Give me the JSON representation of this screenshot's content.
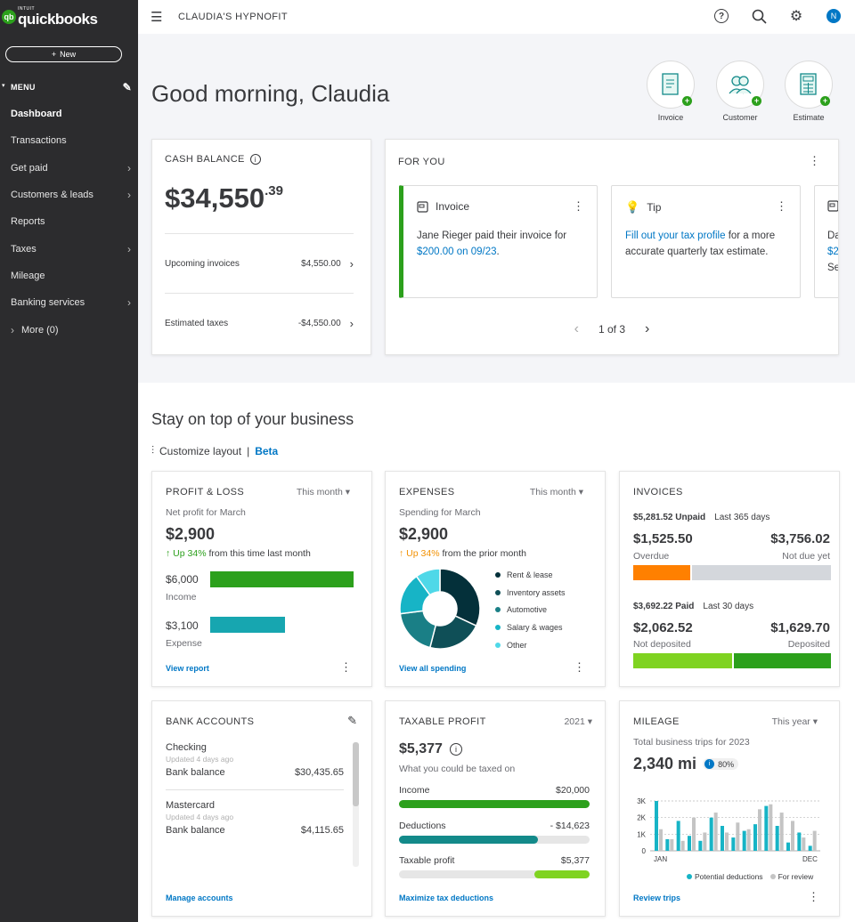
{
  "brand": {
    "intuit": "INTUIT",
    "name": "quickbooks",
    "mark": "qb"
  },
  "sidebar": {
    "new_label": "New",
    "menu_label": "MENU",
    "items": [
      {
        "label": "Dashboard",
        "active": true,
        "chevron": false
      },
      {
        "label": "Transactions",
        "active": false,
        "chevron": false
      },
      {
        "label": "Get paid",
        "active": false,
        "chevron": true
      },
      {
        "label": "Customers & leads",
        "active": false,
        "chevron": true
      },
      {
        "label": "Reports",
        "active": false,
        "chevron": false
      },
      {
        "label": "Taxes",
        "active": false,
        "chevron": true
      },
      {
        "label": "Mileage",
        "active": false,
        "chevron": false
      },
      {
        "label": "Banking services",
        "active": false,
        "chevron": true
      }
    ],
    "more_label": "More (0)"
  },
  "topbar": {
    "company": "CLAUDIA'S HYPNOFIT",
    "avatar_initial": "N"
  },
  "hero": {
    "greeting": "Good morning, Claudia",
    "quick_actions": [
      {
        "label": "Invoice"
      },
      {
        "label": "Customer"
      },
      {
        "label": "Estimate"
      }
    ]
  },
  "cash_balance": {
    "title": "CASH BALANCE",
    "amount_main": "$34,550",
    "amount_cents": ".39",
    "rows": [
      {
        "label": "Upcoming invoices",
        "value": "$4,550.00"
      },
      {
        "label": "Estimated taxes",
        "value": "-$4,550.00"
      }
    ]
  },
  "for_you": {
    "title": "FOR YOU",
    "tiles": [
      {
        "title": "Invoice",
        "text_a": "Jane Rieger paid their invoice for ",
        "link": "$200.00 on 09/23",
        "text_b": "."
      },
      {
        "title": "Tip",
        "link": "Fill out your tax profile",
        "text_b": " for a more accurate quarterly tax estimate."
      },
      {
        "title": "",
        "text_a": "Da",
        "link": "$2",
        "text_b": "Se"
      }
    ],
    "pager": "1 of 3"
  },
  "section": {
    "title": "Stay on top of your business",
    "customize": "Customize layout",
    "beta": "Beta"
  },
  "profit_loss": {
    "title": "PROFIT & LOSS",
    "period": "This month",
    "subtitle": "Net profit for March",
    "amount": "$2,900",
    "change": "Up 34%",
    "change_text": " from this time last month",
    "income_value": "$6,000",
    "income_label": "Income",
    "expense_value": "$3,100",
    "expense_label": "Expense",
    "income_fraction": 1.0,
    "expense_fraction": 0.52,
    "footer": "View report"
  },
  "expenses": {
    "title": "EXPENSES",
    "period": "This month",
    "subtitle": "Spending for March",
    "amount": "$2,900",
    "change": "Up 34%",
    "change_text": " from the prior month",
    "legend": [
      {
        "label": "Rent & lease",
        "color": "#04303a",
        "share": 32
      },
      {
        "label": "Inventory assets",
        "color": "#0f4f57",
        "share": 22
      },
      {
        "label": "Automotive",
        "color": "#1a7f86",
        "share": 19
      },
      {
        "label": "Salary & wages",
        "color": "#17b4c6",
        "share": 17
      },
      {
        "label": "Other",
        "color": "#4fd8e8",
        "share": 10
      }
    ],
    "footer": "View all spending"
  },
  "invoices": {
    "title": "INVOICES",
    "unpaid_total": "$5,281.52 Unpaid",
    "unpaid_period": "Last 365 days",
    "overdue_amount": "$1,525.50",
    "overdue_label": "Overdue",
    "notdue_amount": "$3,756.02",
    "notdue_label": "Not due yet",
    "paid_total": "$3,692.22 Paid",
    "paid_period": "Last 30 days",
    "notdep_amount": "$2,062.52",
    "notdep_label": "Not deposited",
    "dep_amount": "$1,629.70",
    "dep_label": "Deposited",
    "overdue_fraction": 0.29,
    "notdep_fraction": 0.5
  },
  "bank_accounts": {
    "title": "BANK ACCOUNTS",
    "accounts": [
      {
        "name": "Checking",
        "updated": "Updated 4 days ago",
        "balance_label": "Bank balance",
        "balance": "$30,435.65"
      },
      {
        "name": "Mastercard",
        "updated": "Updated 4 days ago",
        "balance_label": "Bank balance",
        "balance": "$4,115.65"
      }
    ],
    "footer": "Manage accounts"
  },
  "taxable_profit": {
    "title": "TAXABLE PROFIT",
    "year": "2021",
    "amount": "$5,377",
    "subtitle": "What you could be taxed on",
    "rows": [
      {
        "label": "Income",
        "value": "$20,000",
        "fraction": 1.0,
        "color": "#2ca01c"
      },
      {
        "label": "Deductions",
        "value": "- $14,623",
        "fraction": 0.73,
        "color": "#138a8a"
      },
      {
        "label": "Taxable profit",
        "value": "$5,377",
        "fraction": 0.29,
        "color": "#7fd321"
      }
    ],
    "footer": "Maximize tax deductions"
  },
  "mileage": {
    "title": "MILEAGE",
    "period": "This year",
    "subtitle": "Total business trips for 2023",
    "amount": "2,340 mi",
    "badge": "80%",
    "footer": "Review trips",
    "legend_a": "Potential deductions",
    "legend_b": "For review",
    "colors": {
      "deductions": "#17b4c6",
      "review": "#c4c4c4"
    },
    "chart_data": {
      "type": "bar",
      "categories_labels": [
        "JAN",
        "DEC"
      ],
      "y_ticks": [
        "3K",
        "2K",
        "1K",
        "0"
      ],
      "ylim": [
        0,
        3000
      ],
      "series": [
        {
          "name": "Potential deductions",
          "values": [
            3000,
            700,
            1800,
            900,
            600,
            2000,
            1500,
            800,
            1200,
            1600,
            2700,
            1500,
            500,
            1100,
            300
          ]
        },
        {
          "name": "For review",
          "values": [
            1300,
            700,
            600,
            2000,
            1100,
            2300,
            1100,
            1700,
            1300,
            2500,
            2800,
            2300,
            1800,
            800,
            1200
          ]
        }
      ]
    }
  }
}
